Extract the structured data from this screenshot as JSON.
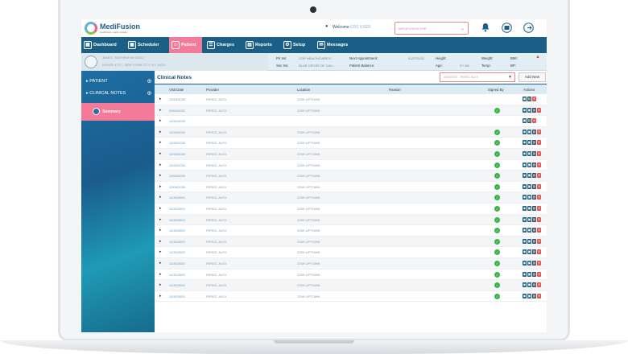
{
  "app": {
    "logo_name": "MediFusion",
    "logo_tagline": "healthcare made simple"
  },
  "header": {
    "welcome_label": "Welcome",
    "welcome_user": "ERS USER",
    "facility_select": "MEDIFUSION EHR"
  },
  "nav": {
    "items": [
      {
        "label": "Dashboard",
        "icon": "dashboard-icon",
        "active": false
      },
      {
        "label": "Scheduler",
        "icon": "calendar-icon",
        "active": false
      },
      {
        "label": "Patient",
        "icon": "patient-icon",
        "active": true
      },
      {
        "label": "Charges",
        "icon": "document-icon",
        "active": false
      },
      {
        "label": "Reports",
        "icon": "reports-icon",
        "active": false
      },
      {
        "label": "Setup",
        "icon": "gear-icon",
        "active": false
      },
      {
        "label": "Messages",
        "icon": "envelope-icon",
        "active": false
      }
    ]
  },
  "patient": {
    "name": "JAMES, MATHEW NA 00012",
    "address": "HOUSE # XX - NEW YORK CITY, NY 10001",
    "pri_ins_label": "Pri Ins:",
    "pri_ins_value": "CGP HEALTHCARE E...",
    "sec_ins_label": "Sec Ins:",
    "sec_ins_value": "BLUE CROSS OF CALI...",
    "next_appt_label": "Next Appointment:",
    "next_appt_value": "01/27/2022",
    "balance_label": "Patient Balance:",
    "balance_value": "",
    "height_label": "Height:",
    "height_value": "",
    "age_label": "Age:",
    "age_value": "2Y 1M",
    "weight_label": "Weight:",
    "weight_value": "",
    "temp_label": "Temp:",
    "temp_value": "",
    "bmi_label": "BMI:",
    "bmi_value": "",
    "bp_label": "BP:",
    "bp_value": ""
  },
  "sidebar": {
    "items": [
      {
        "label": "PATIENT"
      },
      {
        "label": "CLINICAL NOTES"
      }
    ],
    "summary_label": "Summary"
  },
  "notes": {
    "title": "Clinical Notes",
    "filter_value": "03/03/2021 - PEREZ, ALEX",
    "add_new_label": "Add New",
    "columns": [
      "Visit Date",
      "Provider",
      "Location",
      "Reason",
      "Signed By",
      "Actions"
    ],
    "rows": [
      {
        "date": "12/19/2020",
        "provider": "PEREZ, ALEX",
        "location": "225H UPTOWN",
        "signed": false
      },
      {
        "date": "03/04/2021",
        "provider": "PEREZ, ALEX",
        "location": "225H UPTOWN",
        "signed": true
      },
      {
        "date": "12/31/2020",
        "provider": "",
        "location": "",
        "signed": false
      },
      {
        "date": "12/30/2020",
        "provider": "PEREZ, ALEX",
        "location": "225H UPTOWN",
        "signed": true
      },
      {
        "date": "12/30/2020",
        "provider": "PEREZ, ALEX",
        "location": "225H UPTOWN",
        "signed": true
      },
      {
        "date": "12/30/2020",
        "provider": "PEREZ, ALEX",
        "location": "225H UPTOWN",
        "signed": true
      },
      {
        "date": "12/30/2020",
        "provider": "PEREZ, ALEX",
        "location": "225H UPTOWN",
        "signed": true
      },
      {
        "date": "12/04/2020",
        "provider": "PEREZ, ALEX",
        "location": "225H UPTOWN",
        "signed": true
      },
      {
        "date": "12/04/2020",
        "provider": "PEREZ, ALEX",
        "location": "225H UPTOWN",
        "signed": true
      },
      {
        "date": "11/30/2020",
        "provider": "PEREZ, ALEX",
        "location": "225H UPTOWN",
        "signed": true
      },
      {
        "date": "11/30/2020",
        "provider": "PEREZ, ALEX",
        "location": "225H UPTOWN",
        "signed": true
      },
      {
        "date": "11/30/2020",
        "provider": "PEREZ, ALEX",
        "location": "225H UPTOWN",
        "signed": true
      },
      {
        "date": "11/30/2020",
        "provider": "PEREZ, ALEX",
        "location": "225H UPTOWN",
        "signed": true
      },
      {
        "date": "11/30/2020",
        "provider": "PEREZ, ALEX",
        "location": "225H UPTOWN",
        "signed": true
      },
      {
        "date": "11/30/2020",
        "provider": "PEREZ, ALEX",
        "location": "225H UPTOWN",
        "signed": true
      },
      {
        "date": "11/30/2020",
        "provider": "PEREZ, ALEX",
        "location": "225H UPTOWN",
        "signed": true
      },
      {
        "date": "11/30/2020",
        "provider": "PEREZ, ALEX",
        "location": "225H UPTOWN",
        "signed": true
      },
      {
        "date": "11/30/2020",
        "provider": "PEREZ, ALEX",
        "location": "225H UPTOWN",
        "signed": true
      },
      {
        "date": "11/30/2020",
        "provider": "PEREZ, ALEX",
        "location": "225H UPTOWN",
        "signed": true
      }
    ]
  },
  "colors": {
    "nav_bg": "#1b5f86",
    "active": "#f47a9a",
    "signed": "#3cb34a"
  }
}
